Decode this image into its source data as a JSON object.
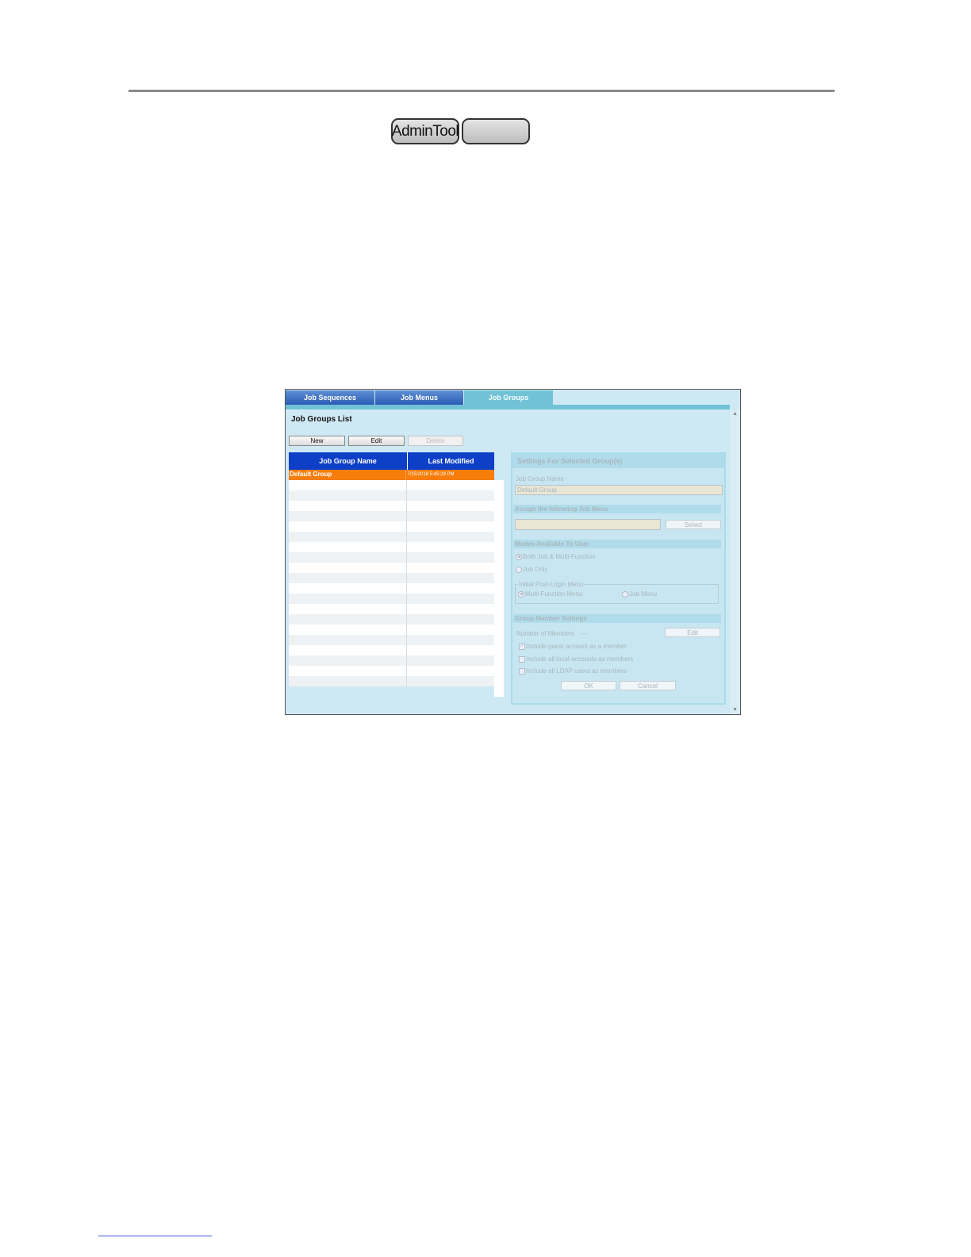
{
  "header": {
    "admin_tool_label": "AdminTool",
    "blank_button_label": ""
  },
  "tabs": [
    {
      "label": "Job Sequences",
      "active": false
    },
    {
      "label": "Job Menus",
      "active": false
    },
    {
      "label": "Job Groups",
      "active": true
    }
  ],
  "job_groups_list": {
    "title": "Job Groups List",
    "buttons": {
      "new": "New",
      "edit": "Edit",
      "delete": "Delete"
    },
    "columns": [
      "Job Group Name",
      "Last Modified"
    ],
    "rows": [
      {
        "name": "Default Group",
        "modified": "7/15/2018 5:45:29 PM",
        "selected": true
      }
    ]
  },
  "settings_panel": {
    "header": "Settings For Selected Group(s)",
    "job_group_name_label": "Job Group Name",
    "job_group_name_value": "Default Group",
    "assign_menu_section": "Assign the following Job Menu",
    "assign_menu_value": "",
    "select_button": "Select",
    "modes_section": "Modes Available To User",
    "mode_both": "Both Job & Multi-Function",
    "mode_job_only": "Job Only",
    "initial_menu_legend": "Initial Post-Login Menu",
    "initial_multi_function": "Multi-Function Menu",
    "initial_job_menu": "Job Menu",
    "group_member_section": "Group Member Settings",
    "number_of_members_label": "Number of Members",
    "number_of_members_value": "---",
    "members_edit_button": "Edit",
    "include_guest": "Include guest account as a member",
    "include_local": "Include all local accounts as members",
    "include_ldap": "Include all LDAP users as members",
    "ok_button": "OK",
    "cancel_button": "Cancel"
  },
  "colors": {
    "tab_active": "#71c2d6",
    "tab_inactive": "#2c5cb4",
    "table_header": "#0d3fc7",
    "selected_row": "#f77d0c",
    "window_bg": "#cfe9f4"
  }
}
